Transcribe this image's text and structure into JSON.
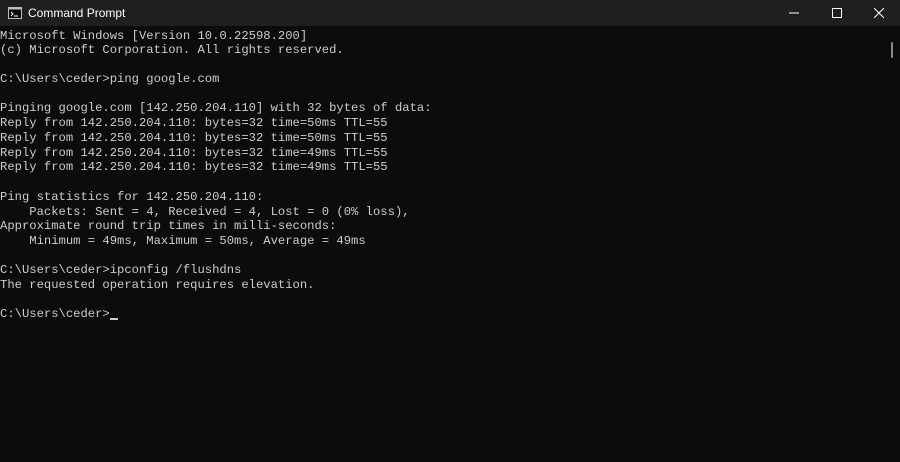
{
  "window": {
    "title": "Command Prompt",
    "icon": "cmd-icon"
  },
  "controls": {
    "minimize_icon": "minimize-icon",
    "maximize_icon": "maximize-icon",
    "close_icon": "close-icon"
  },
  "console": {
    "lines": [
      "Microsoft Windows [Version 10.0.22598.200]",
      "(c) Microsoft Corporation. All rights reserved.",
      "",
      "C:\\Users\\ceder>ping google.com",
      "",
      "Pinging google.com [142.250.204.110] with 32 bytes of data:",
      "Reply from 142.250.204.110: bytes=32 time=50ms TTL=55",
      "Reply from 142.250.204.110: bytes=32 time=50ms TTL=55",
      "Reply from 142.250.204.110: bytes=32 time=49ms TTL=55",
      "Reply from 142.250.204.110: bytes=32 time=49ms TTL=55",
      "",
      "Ping statistics for 142.250.204.110:",
      "    Packets: Sent = 4, Received = 4, Lost = 0 (0% loss),",
      "Approximate round trip times in milli-seconds:",
      "    Minimum = 49ms, Maximum = 50ms, Average = 49ms",
      "",
      "C:\\Users\\ceder>ipconfig /flushdns",
      "The requested operation requires elevation.",
      "",
      "C:\\Users\\ceder>"
    ]
  },
  "colors": {
    "background": "#0c0c0c",
    "titlebar": "#1f1f1f",
    "text": "#cccccc"
  }
}
